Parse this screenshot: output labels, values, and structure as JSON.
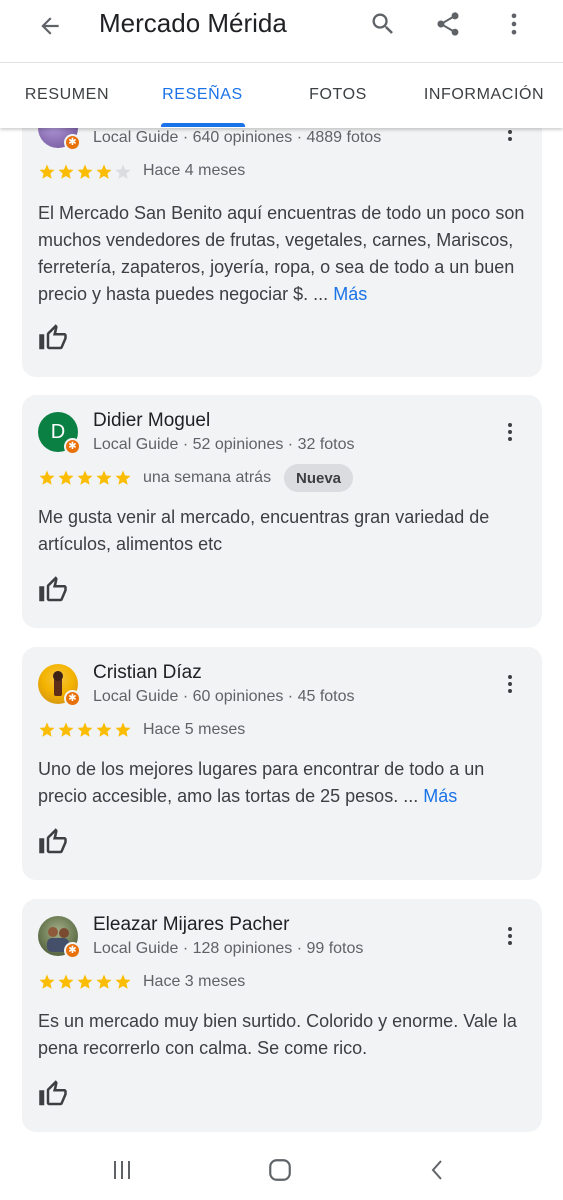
{
  "appbar": {
    "title": "Mercado Mérida",
    "back_icon": "arrow-back-icon",
    "search_icon": "search-icon",
    "share_icon": "share-icon",
    "more_icon": "more-vert-icon"
  },
  "tabs": [
    {
      "label": "RESUMEN",
      "selected": false
    },
    {
      "label": "RESEÑAS",
      "selected": true
    },
    {
      "label": "FOTOS",
      "selected": false
    },
    {
      "label": "INFORMACIÓN",
      "selected": false
    }
  ],
  "colors": {
    "accent": "#1a73e8",
    "star": "#fbbc04",
    "star_empty": "#dadce0",
    "card_bg": "#f1f3f4",
    "local_guide_badge": "#e8710a"
  },
  "reviews": [
    {
      "author": "",
      "meta": "Local Guide · 640 opiniones · 4889 fotos",
      "rating": 4,
      "when": "Hace 4 meses",
      "text": "El Mercado San Benito aquí encuentras de todo un poco son muchos vendedores de frutas, vegetales, carnes, Mariscos, ferretería, zapateros, joyería, ropa, o sea de todo a un buen precio y hasta puedes negociar $. ...",
      "more": "Más"
    },
    {
      "author": "Didier Moguel",
      "avatar_letter": "D",
      "avatar_color": "#0b8043",
      "meta": "Local Guide · 52 opiniones · 32 fotos",
      "rating": 5,
      "when": "una semana atrás",
      "badge": "Nueva",
      "text": "Me gusta venir al mercado, encuentras gran variedad de artículos, alimentos etc"
    },
    {
      "author": "Cristian Díaz",
      "meta": "Local Guide · 60 opiniones · 45 fotos",
      "rating": 5,
      "when": "Hace 5 meses",
      "text": "Uno de los mejores lugares para encontrar de todo a un precio accesible, amo las tortas de 25 pesos. ...",
      "more": "Más"
    },
    {
      "author": "Eleazar Mijares Pacher",
      "meta": "Local Guide · 128 opiniones · 99 fotos",
      "rating": 5,
      "when": "Hace 3 meses",
      "text": "Es un mercado muy bien surtido. Colorido y enorme. Vale la pena recorrerlo con calma. Se come rico."
    }
  ],
  "navbar": {
    "recents_icon": "recents-icon",
    "home_icon": "home-icon",
    "back_icon": "nav-back-icon"
  }
}
